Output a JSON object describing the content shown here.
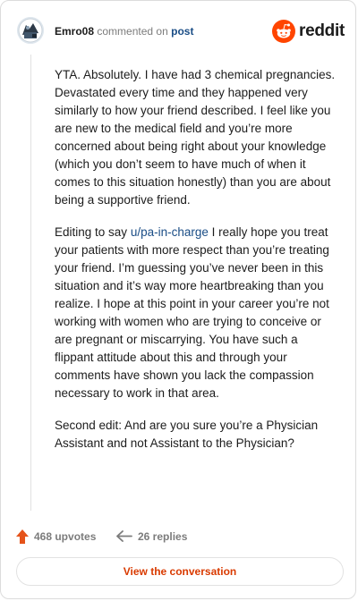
{
  "header": {
    "username": "Emro08",
    "commented_text": "commented on",
    "post_link": "post",
    "brand": "reddit"
  },
  "comment": {
    "paragraph1": "YTA. Absolutely. I have had 3 chemical pregnancies. Devastated every time and they happened very similarly to how your friend described. I feel like you are new to the medical field and you’re more concerned about being right about your knowledge (which you don’t seem to have much of when it comes to this situation honestly) than you are about being a supportive friend.",
    "paragraph2_prefix": "Editing to say",
    "paragraph2_mention": "u/pa-in-charge",
    "paragraph2_rest": "I really hope you treat your patients with more respect than you’re treating your friend. I’m guessing you’ve never been in this situation and it’s way more heartbreaking than you realize. I hope at this point in your career you’re not working with women who are trying to conceive or are pregnant or miscarrying. You have such a flippant attitude about this and through your comments have shown you lack the compassion necessary to work in that area.",
    "paragraph3": "Second edit: And are you sure you’re a Physician Assistant and not Assistant to the Physician?"
  },
  "footer": {
    "upvotes": "468 upvotes",
    "replies": "26 replies",
    "view_button": "View the conversation"
  },
  "colors": {
    "brand_orange": "#ff4500",
    "upvote_red": "#e5531a",
    "link_blue": "#1a4d86",
    "button_text": "#d93a00"
  },
  "icons": {
    "avatar": "user-avatar-icon",
    "reddit_logo": "reddit-snoo-icon",
    "upvote": "upvote-arrow-icon",
    "reply": "reply-arrow-icon"
  }
}
